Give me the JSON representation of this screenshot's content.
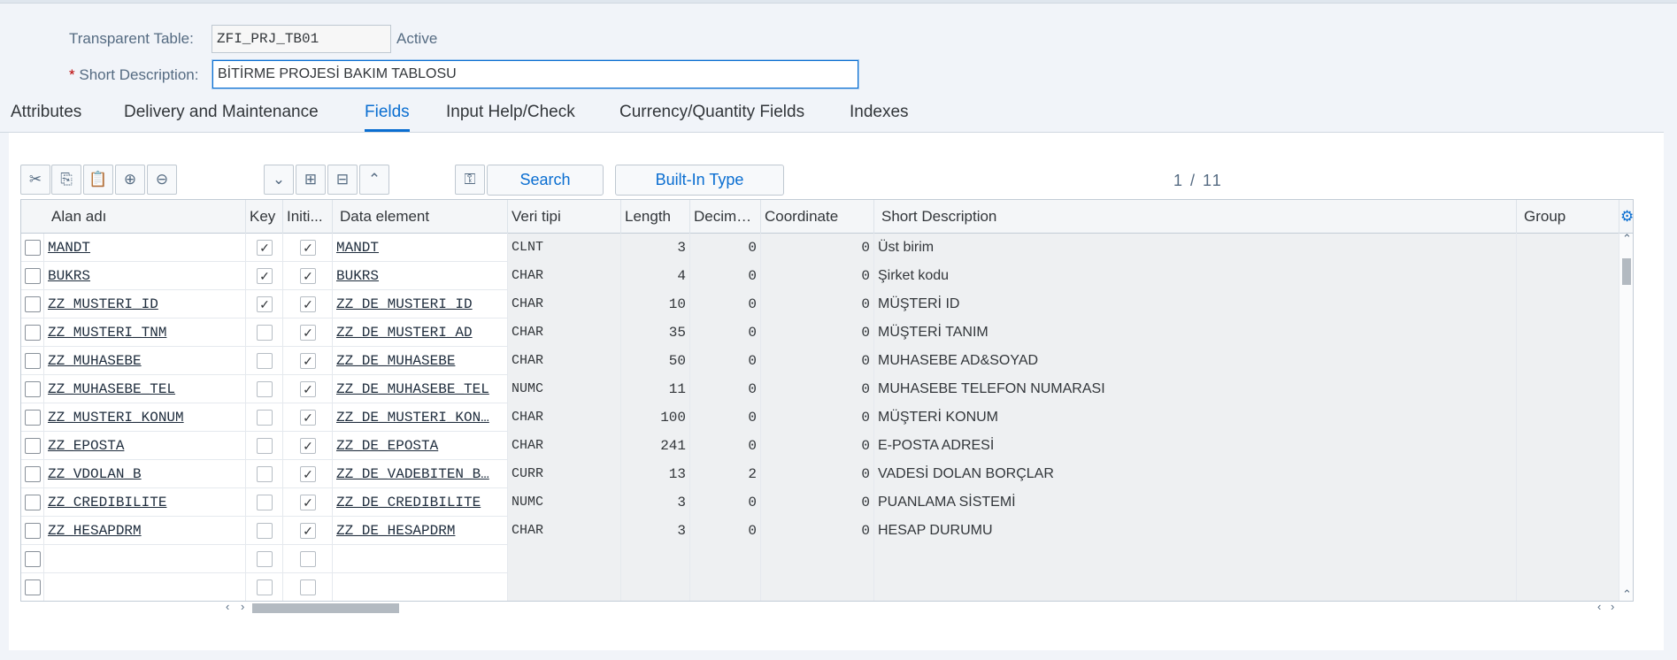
{
  "header": {
    "table_label": "Transparent Table:",
    "table_value": "ZFI_PRJ_TB01",
    "status": "Active",
    "required_mark": "*",
    "short_desc_label": "Short Description:",
    "short_desc_value": "BİTİRME PROJESİ BAKIM TABLOSU"
  },
  "tabs": [
    {
      "label": "Attributes"
    },
    {
      "label": "Delivery and Maintenance"
    },
    {
      "label": "Fields"
    },
    {
      "label": "Input Help/Check"
    },
    {
      "label": "Currency/Quantity Fields"
    },
    {
      "label": "Indexes"
    }
  ],
  "active_tab": "Fields",
  "toolbar": {
    "icons": [
      "cut-icon",
      "copy-icon",
      "paste-icon",
      "insert-row-icon",
      "delete-row-icon",
      "expand-all-icon",
      "insert-icon",
      "collapse-icon",
      "collapse-all-icon",
      "search-key-icon"
    ],
    "search_label": "Search",
    "builtin_label": "Built-In Type",
    "pager": "1 / 11"
  },
  "columns": [
    "Alan adı",
    "Key",
    "Initi...",
    "Data element",
    "Veri tipi",
    "Length",
    "Decima...",
    "Coordinate",
    "Short Description",
    "Group"
  ],
  "rows": [
    {
      "field": "MANDT",
      "key": true,
      "init": true,
      "element": "MANDT",
      "type": "CLNT",
      "length": "3",
      "decimals": "0",
      "coord": "0",
      "desc": "Üst birim"
    },
    {
      "field": "BUKRS",
      "key": true,
      "init": true,
      "element": "BUKRS",
      "type": "CHAR",
      "length": "4",
      "decimals": "0",
      "coord": "0",
      "desc": "Şirket kodu"
    },
    {
      "field": "ZZ_MUSTERI_ID",
      "key": true,
      "init": true,
      "element": "ZZ_DE_MUSTERI_ID",
      "type": "CHAR",
      "length": "10",
      "decimals": "0",
      "coord": "0",
      "desc": "MÜŞTERİ ID"
    },
    {
      "field": "ZZ_MUSTERI_TNM",
      "key": false,
      "init": true,
      "element": "ZZ_DE_MUSTERI_AD",
      "type": "CHAR",
      "length": "35",
      "decimals": "0",
      "coord": "0",
      "desc": "MÜŞTERİ TANIM"
    },
    {
      "field": "ZZ_MUHASEBE",
      "key": false,
      "init": true,
      "element": "ZZ_DE_MUHASEBE",
      "type": "CHAR",
      "length": "50",
      "decimals": "0",
      "coord": "0",
      "desc": "MUHASEBE AD&SOYAD"
    },
    {
      "field": "ZZ_MUHASEBE_TEL",
      "key": false,
      "init": true,
      "element": "ZZ_DE_MUHASEBE_TEL",
      "type": "NUMC",
      "length": "11",
      "decimals": "0",
      "coord": "0",
      "desc": "MUHASEBE TELEFON NUMARASI"
    },
    {
      "field": "ZZ_MUSTERI_KONUM",
      "key": false,
      "init": true,
      "element": "ZZ_DE_MUSTERI_KON…",
      "type": "CHAR",
      "length": "100",
      "decimals": "0",
      "coord": "0",
      "desc": "MÜŞTERİ KONUM"
    },
    {
      "field": "ZZ_EPOSTA",
      "key": false,
      "init": true,
      "element": "ZZ_DE_EPOSTA",
      "type": "CHAR",
      "length": "241",
      "decimals": "0",
      "coord": "0",
      "desc": "E-POSTA ADRESİ"
    },
    {
      "field": "ZZ_VDOLAN_B",
      "key": false,
      "init": true,
      "element": "ZZ_DE_VADEBITEN_B…",
      "type": "CURR",
      "length": "13",
      "decimals": "2",
      "coord": "0",
      "desc": "VADESİ DOLAN BORÇLAR"
    },
    {
      "field": "ZZ_CREDIBILITE",
      "key": false,
      "init": true,
      "element": "ZZ_DE_CREDIBILITE",
      "type": "NUMC",
      "length": "3",
      "decimals": "0",
      "coord": "0",
      "desc": "PUANLAMA SİSTEMİ"
    },
    {
      "field": "ZZ_HESAPDRM",
      "key": false,
      "init": true,
      "element": "ZZ_DE_HESAPDRM",
      "type": "CHAR",
      "length": "3",
      "decimals": "0",
      "coord": "0",
      "desc": "HESAP DURUMU"
    },
    {
      "field": "",
      "key": false,
      "init": false,
      "element": "",
      "type": "",
      "length": "",
      "decimals": "",
      "coord": "",
      "desc": ""
    },
    {
      "field": "",
      "key": false,
      "init": false,
      "element": "",
      "type": "",
      "length": "",
      "decimals": "",
      "coord": "",
      "desc": ""
    }
  ],
  "colors": {
    "accent": "#0a6ed1",
    "background": "#f1f4f9",
    "readonly_cell": "#eef0f2"
  }
}
